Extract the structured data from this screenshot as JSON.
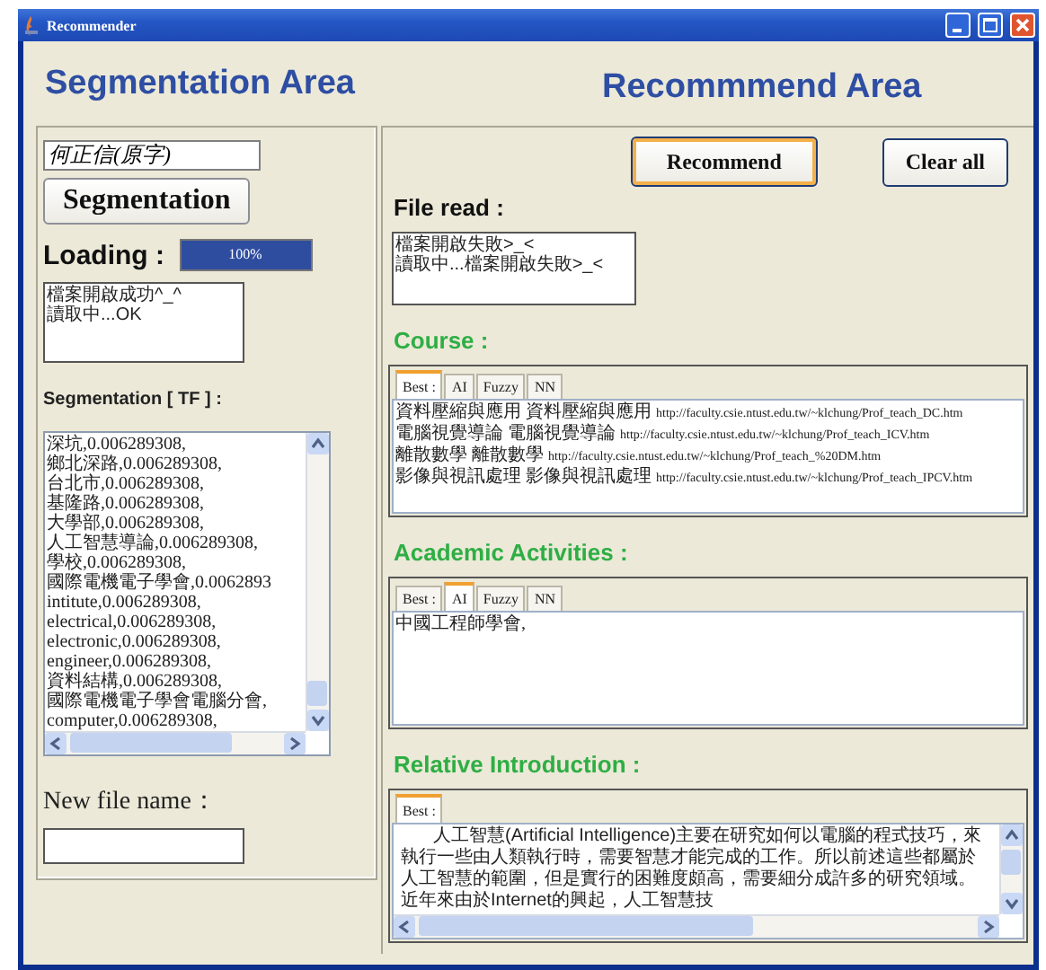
{
  "window": {
    "title": "Recommender"
  },
  "segmentation": {
    "heading": "Segmentation Area",
    "input": {
      "value": "何正信(原字)"
    },
    "segment_button": "Segmentation",
    "loading": {
      "label": "Loading :",
      "level": 1,
      "reading": "100%"
    },
    "status": [
      "檔案開啟成功^_^",
      "讀取中...OK"
    ],
    "tf_label": "Segmentation [ TF ] :",
    "tf_list": [
      "深坑,0.006289308,",
      "鄉北深路,0.006289308,",
      "台北市,0.006289308,",
      "基隆路,0.006289308,",
      "大學部,0.006289308,",
      "人工智慧導論,0.006289308,",
      "學校,0.006289308,",
      "國際電機電子學會,0.0062893",
      "intitute,0.006289308,",
      "electrical,0.006289308,",
      "electronic,0.006289308,",
      "engineer,0.006289308,",
      "資料結構,0.006289308,",
      "國際電機電子學會電腦分會,",
      "computer,0.006289308,"
    ],
    "new_file_label": "New file name："
  },
  "recommend": {
    "heading": "Recommmend Area",
    "buttons": [
      {
        "label": "Recommend",
        "focused": true
      },
      {
        "label": "Clear all",
        "focused": false
      }
    ],
    "file_read_label": "File read :",
    "file_read": [
      "檔案開啟失敗>_<",
      "讀取中...檔案開啟失敗>_<"
    ],
    "course": {
      "label": "Course :",
      "tabs": [
        {
          "label": "Best :",
          "selected": true
        },
        {
          "label": "AI",
          "selected": false
        },
        {
          "label": "Fuzzy",
          "selected": false
        },
        {
          "label": "NN",
          "selected": false
        }
      ],
      "items": [
        {
          "name": "資料壓縮與應用 資料壓縮與應用",
          "url": "http://faculty.csie.ntust.edu.tw/~klchung/Prof_teach_DC.htm"
        },
        {
          "name": "電腦視覺導論 電腦視覺導論",
          "url": "http://faculty.csie.ntust.edu.tw/~klchung/Prof_teach_ICV.htm"
        },
        {
          "name": "離散數學 離散數學",
          "url": "http://faculty.csie.ntust.edu.tw/~klchung/Prof_teach_%20DM.htm"
        },
        {
          "name": "影像與視訊處理 影像與視訊處理",
          "url": "http://faculty.csie.ntust.edu.tw/~klchung/Prof_teach_IPCV.htm"
        }
      ]
    },
    "academic": {
      "label": "Academic Activities :",
      "tabs": [
        {
          "label": "Best :",
          "selected": false
        },
        {
          "label": "AI",
          "selected": true
        },
        {
          "label": "Fuzzy",
          "selected": false
        },
        {
          "label": "NN",
          "selected": false
        }
      ],
      "items": [
        {
          "name": "中國工程師學會,"
        }
      ]
    },
    "introduction": {
      "label": "Relative Introduction :",
      "tabs": [
        {
          "label": "Best :",
          "selected": true
        }
      ],
      "text": "人工智慧(Artificial Intelligence)主要在研究如何以電腦的程式技巧，來執行一些由人類執行時，需要智慧才能完成的工作。所以前述這些都屬於人工智慧的範圍，但是實行的困難度頗高，需要細分成許多的研究領域。近年來由於Internet的興起，人工智慧技"
    }
  }
}
